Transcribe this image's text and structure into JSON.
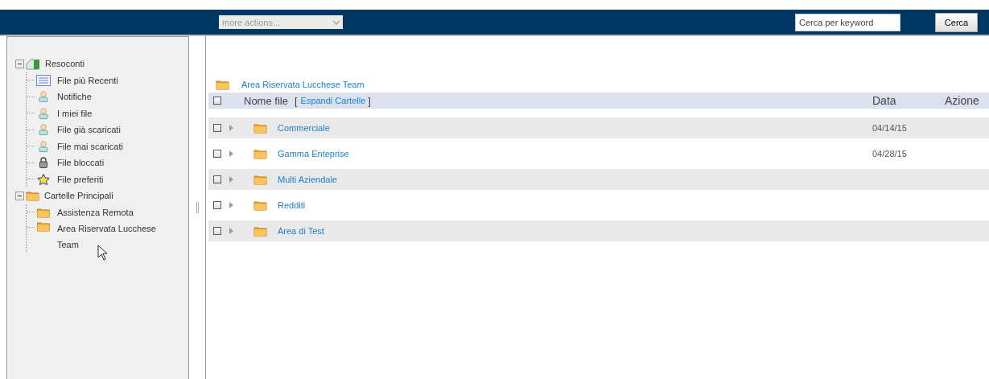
{
  "toolbar": {
    "actions_dropdown": {
      "placeholder": "more actions...",
      "disabled": true
    },
    "search": {
      "placeholder": "Cerca per keyword"
    },
    "search_button": "Cerca"
  },
  "sidebar": {
    "tree": [
      {
        "label": "Resoconti",
        "kind": "home",
        "expanded": true,
        "children": [
          {
            "label": "File più Recenti",
            "kind": "list"
          },
          {
            "label": "Notifiche",
            "kind": "user"
          },
          {
            "label": "I miei file",
            "kind": "user"
          },
          {
            "label": "File già scaricati",
            "kind": "user"
          },
          {
            "label": "File mai scaricati",
            "kind": "user"
          },
          {
            "label": "File bloccati",
            "kind": "lock"
          },
          {
            "label": "File preferiti",
            "kind": "star"
          }
        ]
      },
      {
        "label": "Cartelle Principali",
        "kind": "folder",
        "expanded": true,
        "children": [
          {
            "label": "Assistenza Remota",
            "kind": "folder"
          },
          {
            "label": "Area Riservata Lucchese Team",
            "kind": "folder"
          }
        ]
      }
    ]
  },
  "breadcrumb": "Area Riservata Lucchese Team",
  "table": {
    "select_all_checked": false,
    "columns": [
      "Nome file",
      "Data",
      "Azione"
    ],
    "bracket_open": "[",
    "expand_link": "Espandi Cartelle",
    "bracket_close": "]",
    "rows": [
      {
        "name": "Commerciale",
        "date": "04/14/15",
        "checked": false
      },
      {
        "name": "Gamma Enteprise",
        "date": "04/28/15",
        "checked": false
      },
      {
        "name": "Multi Aziendale",
        "checked": false
      },
      {
        "name": "Redditi",
        "checked": false
      },
      {
        "name": "Area di Test",
        "checked": false
      }
    ]
  }
}
